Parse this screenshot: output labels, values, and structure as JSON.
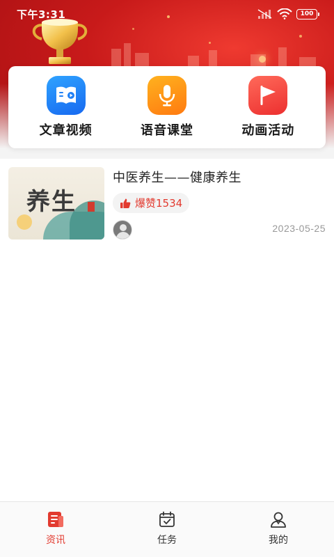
{
  "status_bar": {
    "time": "下午3:31",
    "battery": "100"
  },
  "quick_actions": [
    {
      "label": "文章视频",
      "icon": "book-video-icon",
      "color": "#1f80f6"
    },
    {
      "label": "语音课堂",
      "icon": "microphone-icon",
      "color": "#ff9a18"
    },
    {
      "label": "动画活动",
      "icon": "flag-icon",
      "color": "#f0443b"
    }
  ],
  "articles": [
    {
      "title": "中医养生——健康养生",
      "likes": "爆赞1534",
      "date": "2023-05-25",
      "thumbnail_text": "养生"
    }
  ],
  "tabs": [
    {
      "label": "资讯",
      "icon": "news-icon",
      "active": true
    },
    {
      "label": "任务",
      "icon": "calendar-check-icon",
      "active": false
    },
    {
      "label": "我的",
      "icon": "profile-icon",
      "active": false
    }
  ],
  "colors": {
    "accent": "#e23a2f",
    "banner": "#c81a1a"
  }
}
